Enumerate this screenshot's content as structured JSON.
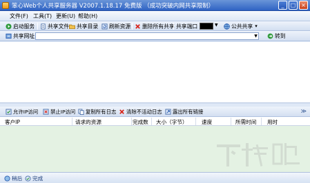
{
  "window": {
    "title": "笨心Web个人共享服务器 V2007.1.18.17 免费版 （成功突破内网共享限制）",
    "buttons": {
      "minimize": "_",
      "maximize": "□",
      "close": "×"
    }
  },
  "menu": [
    "文件(F)",
    "工具(T)",
    "更新(U)",
    "帮助(H)"
  ],
  "toolbar": {
    "start_service": "启动服务",
    "share_file": "共享文件",
    "share_dir": "共享目录",
    "refresh": "刷新资源",
    "delete_all": "删除所有共享",
    "share_port": "共享端口",
    "public_share": "公共共享",
    "public_share_arrow": "▾"
  },
  "address_bar": {
    "label": "共享网址",
    "value": "",
    "go": "转到"
  },
  "log_toolbar": {
    "allow_ip": "允许IP访问",
    "block_ip": "禁止IP访问",
    "copy_log": "复制所有日志",
    "clear_inactive": "清除不活动日志",
    "export_links": "露出所有链接",
    "collapse": "≫"
  },
  "table": {
    "columns": [
      "客户IP",
      "请求的资源",
      "完成数",
      "大小（字节）",
      "速度",
      "所需时间",
      "用时"
    ],
    "rows": []
  },
  "status": {
    "left": "稍后",
    "right": "完成"
  },
  "watermark": {
    "text": "下载吧",
    "url": "www.xiazaiba.com"
  },
  "colors": {
    "title_bar": "#2f63c4",
    "list_background": "#e4f2e3",
    "accent": "#2a5db0"
  }
}
